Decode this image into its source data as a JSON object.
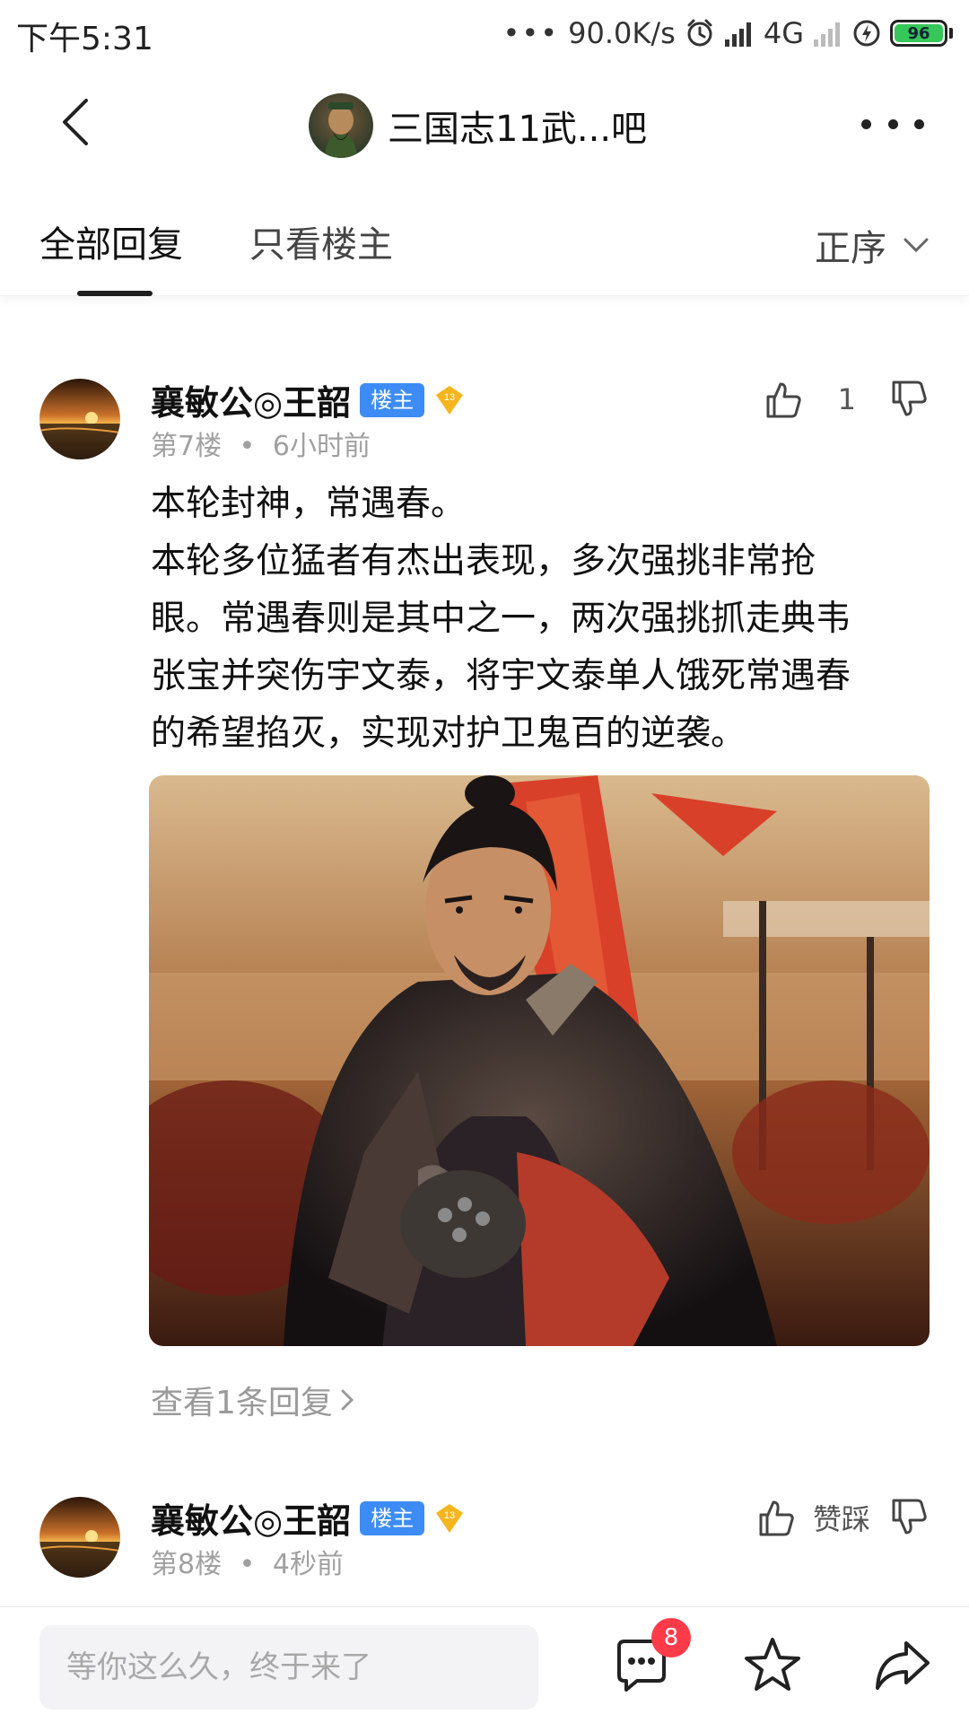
{
  "status_bar": {
    "time": "下午5:31",
    "dots": "•••",
    "net_speed": "90.0K/s",
    "network": "4G",
    "battery_level": "96",
    "alarm_icon": "alarm-clock-icon",
    "signal_icon": "signal-bars-icon",
    "charging_icon": "bolt-icon"
  },
  "header": {
    "title": "三国志11武...吧",
    "back_icon": "chevron-left-icon",
    "more_icon": "more-dots-icon"
  },
  "tabs": {
    "all_replies": "全部回复",
    "owner_only": "只看楼主",
    "sort_label": "正序",
    "sort_icon": "chevron-down-icon"
  },
  "posts": [
    {
      "username": "襄敏公◎王韶",
      "owner_badge": "楼主",
      "level": "13",
      "floor": "第7楼",
      "separator": "•",
      "time": "6小时前",
      "like_count": "1",
      "content_lines": [
        "本轮封神，常遇春。",
        "本轮多位猛者有杰出表现，多次强挑非常抢",
        "眼。常遇春则是其中之一，两次强挑抓走典韦",
        "张宝并突伤宇文泰，将宇文泰单人饿死常遇春",
        "的希望掐灭，实现对护卫鬼百的逆袭。"
      ],
      "view_replies": "查看1条回复"
    },
    {
      "username": "襄敏公◎王韶",
      "owner_badge": "楼主",
      "level": "13",
      "floor": "第8楼",
      "separator": "•",
      "time": "4秒前",
      "like_label": "赞踩"
    }
  ],
  "bottom_bar": {
    "reply_placeholder": "等你这么久，终于来了",
    "message_badge": "8",
    "message_icon": "chat-bubble-icon",
    "favorite_icon": "star-icon",
    "share_icon": "share-arrow-icon"
  },
  "colors": {
    "accent_blue": "#3d8cf5",
    "badge_red": "#ff3b4a",
    "level_gold": "#f5b51f",
    "battery_green": "#35c759"
  }
}
